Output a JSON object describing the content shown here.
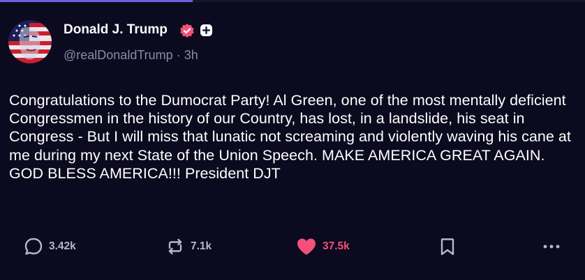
{
  "post": {
    "author": {
      "name": "Donald J. Trump",
      "handle": "@realDonaldTrump",
      "separator": "·",
      "time": "3h",
      "verified": true
    },
    "body": "Congratulations to the Dumocrat Party! Al Green, one of the most mentally deficient Congressmen in the history of our Country, has lost, in a landslide, his seat in Congress - But I will miss that lunatic not screaming and violently waving his cane at me during my next State of the Union Speech. MAKE AMERICA GREAT AGAIN. GOD BLESS AMERICA!!! President DJT",
    "stats": {
      "replies": "3.42k",
      "reposts": "7.1k",
      "likes": "37.5k"
    }
  },
  "icons": {
    "verified": "verified-badge-icon",
    "follow": "plus-icon",
    "reply": "speech-bubble-icon",
    "repost": "repost-arrows-icon",
    "like": "heart-icon",
    "bookmark": "bookmark-icon",
    "more": "more-dots-icon"
  },
  "colors": {
    "background": "#0b0a1e",
    "accent_progress": "#6e63d9",
    "like": "#f4507a",
    "verified": "#f4507a",
    "muted_text": "#8d8aa8"
  }
}
